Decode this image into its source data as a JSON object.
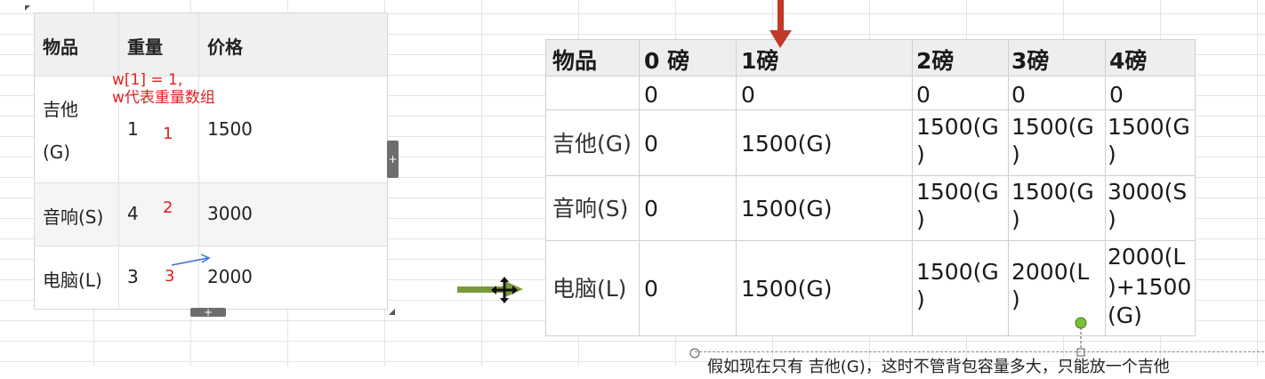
{
  "left_table": {
    "headers": [
      "物品",
      "重量",
      "价格"
    ],
    "rows": [
      {
        "item_line1": "吉他",
        "item_line2": "(G)",
        "weight": "1",
        "index": "1",
        "price": "1500"
      },
      {
        "item": "音响(S)",
        "weight": "4",
        "index": "2",
        "price": "3000"
      },
      {
        "item": "电脑(L)",
        "weight": "3",
        "index": "3",
        "price": "2000"
      }
    ],
    "annotation_line1": "w[1] = 1,",
    "annotation_line2": "w代表重量数组"
  },
  "right_table": {
    "headers": [
      "物品",
      "0 磅",
      "1磅",
      "2磅",
      "3磅",
      "4磅"
    ],
    "rows": [
      {
        "item": "",
        "cells": [
          [
            "0"
          ],
          [
            "0"
          ],
          [
            "0"
          ],
          [
            "0"
          ],
          [
            "0"
          ]
        ]
      },
      {
        "item": "吉他(G)",
        "cells": [
          [
            "0"
          ],
          [
            "1500(G)"
          ],
          [
            "1500(G",
            ")"
          ],
          [
            "1500(G",
            ")"
          ],
          [
            "1500(G",
            ")"
          ]
        ]
      },
      {
        "item": "音响(S)",
        "cells": [
          [
            "0"
          ],
          [
            "1500(G)"
          ],
          [
            "1500(G",
            ")"
          ],
          [
            "1500(G",
            ")"
          ],
          [
            "3000(S",
            ")"
          ]
        ]
      },
      {
        "item": "电脑(L)",
        "cells": [
          [
            "0"
          ],
          [
            "1500(G)"
          ],
          [
            "1500(G",
            ")"
          ],
          [
            "2000(L",
            ")"
          ],
          [
            "2000(L",
            ")+1500",
            "(G)"
          ]
        ]
      }
    ]
  },
  "footer_text": "假如现在只有 吉他(G)，这时不管背包容量多大，只能放一个吉他",
  "colors": {
    "accent_red": "#e02020",
    "arrow_dark_red": "#c0392b",
    "arrow_green": "#7a9a3a",
    "arrow_blue": "#3a6fd8",
    "handle_green": "#7bbf3a"
  }
}
